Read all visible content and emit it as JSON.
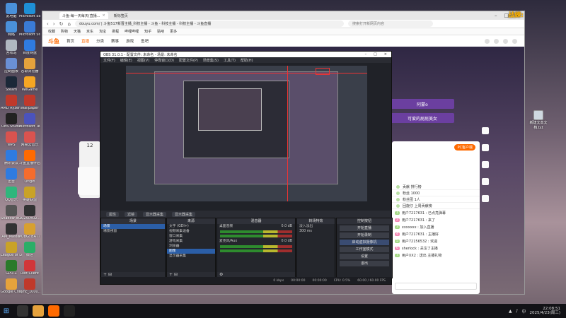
{
  "desktop": {
    "icons": [
      {
        "label": "此电脑",
        "color": "#4a90d9"
      },
      {
        "label": "Microsoft Edge",
        "color": "#1e8fd6"
      },
      {
        "label": "网络",
        "color": "#4a90d9"
      },
      {
        "label": "Microsoft Store",
        "color": "#3a7bd5"
      },
      {
        "label": "回收站",
        "color": "#b0b8c0"
      },
      {
        "label": "百度网盘",
        "color": "#2f7be0"
      },
      {
        "label": "控制面板",
        "color": "#6a8fd5"
      },
      {
        "label": "谷歌浏览器",
        "color": "#e6a23c"
      },
      {
        "label": "Steam",
        "color": "#1b2838"
      },
      {
        "label": "WeGame",
        "color": "#f5a623"
      },
      {
        "label": "AMD Ryzen Master",
        "color": "#c0392b"
      },
      {
        "label": "Wallpaper",
        "color": "#c0392b"
      },
      {
        "label": "OBS Studio",
        "color": "#222222"
      },
      {
        "label": "Microsoft Teams",
        "color": "#4b53bc"
      },
      {
        "label": "WPS",
        "color": "#d9534f"
      },
      {
        "label": "网易云音乐",
        "color": "#d9534f"
      },
      {
        "label": "腾讯会议",
        "color": "#2f7be0"
      },
      {
        "label": "斗鱼直播伴侣",
        "color": "#ff6a00"
      },
      {
        "label": "迅雷",
        "color": "#2f7be0"
      },
      {
        "label": "Origin",
        "color": "#f56c2d"
      },
      {
        "label": "QQ音乐",
        "color": "#2fb67c"
      },
      {
        "label": "英雄联盟",
        "color": "#c9a227"
      },
      {
        "label": "Shadow of the Tomb...",
        "color": "#555555"
      },
      {
        "label": "20250402...",
        "color": "#333333"
      },
      {
        "label": "AM_Master",
        "color": "#333333"
      },
      {
        "label": "PUBG: BATTLEGR...",
        "color": "#d8a030"
      },
      {
        "label": "League of Legends",
        "color": "#c9a227"
      },
      {
        "label": "微信",
        "color": "#2aae67"
      },
      {
        "label": "GPU-Z",
        "color": "#2a7a2a"
      },
      {
        "label": "Riot Client",
        "color": "#d13639"
      },
      {
        "label": "Google Chrome",
        "color": "#e6a23c"
      },
      {
        "label": "sync_1000...",
        "color": "#c0392b"
      }
    ],
    "recycle_bin": "新建文本文档.txt",
    "brand_tag": "战練:"
  },
  "browser": {
    "tabs": [
      {
        "label": "斗鱼-每一天每天(直播...",
        "active": true
      },
      {
        "label": "新标签页",
        "active": false
      }
    ],
    "url": "douyu.com/ | 斗鱼517新晋主播_科技主播 - 斗鱼 - 科技主播 - 科技主播 - 斗鱼直播",
    "search_placeholder": "搜索打开新网页内容",
    "bookmarks": [
      "收藏",
      "购物",
      "天猫",
      "京东",
      "淘宝",
      "携程",
      "哔哩哔哩",
      "知乎",
      "贴吧",
      "更多"
    ]
  },
  "site": {
    "logo": "斗鱼",
    "nav": [
      {
        "label": "首页",
        "active": false
      },
      {
        "label": "直播",
        "active": true
      },
      {
        "label": "分类",
        "active": false
      },
      {
        "label": "赛事",
        "active": false
      },
      {
        "label": "游戏",
        "active": false
      },
      {
        "label": "鱼吧",
        "active": false
      }
    ],
    "rank_number": "12",
    "right_buttons": [
      "阿蒙o",
      "可爱的屁屁美女"
    ],
    "pc_button": "PC客户端",
    "ranks": [
      "贡献 排行榜",
      "粉丝 1000",
      "粉丝团 1人",
      "回旋仔 上周贡献榜"
    ],
    "chat": [
      {
        "badge": "1",
        "text": "用户7217631 : 已点亮弹幕"
      },
      {
        "badge": "2",
        "text": "用户7217631 : 来了"
      },
      {
        "badge": "3",
        "text": "xxxxxxx : 加入直播"
      },
      {
        "badge": "4",
        "text": "用户7217631 : 主播好"
      },
      {
        "badge": "5",
        "text": "用户72156532 : 欢迎"
      },
      {
        "badge": "6",
        "text": "sherlock : 关注了主播"
      },
      {
        "badge": "7",
        "text": "用户XX2 : 送出 主播礼物"
      }
    ]
  },
  "obs": {
    "title": "OBS 31.0.1 - 配置文件: 未命名 - 场景: 未命名",
    "menu": [
      "文件(F)",
      "编辑(E)",
      "视图(V)",
      "停靠窗口(D)",
      "配置文件(P)",
      "场景集(S)",
      "工具(T)",
      "帮助(H)"
    ],
    "toolbar": [
      "属性",
      "滤镜",
      "显示器采集",
      "显示器采集"
    ],
    "scene_header": "场景",
    "scenes": [
      "场景",
      "場景視窗"
    ],
    "sources_header": "来源",
    "sources": [
      "文字 (GDI+)",
      "视频采集设备",
      "窗口采集",
      "游戏采集",
      "浏览器",
      "图像",
      "显示器采集"
    ],
    "mixer_header": "混音器",
    "mixer": [
      {
        "label": "桌面音频",
        "db": "0.0 dB"
      },
      {
        "label": "麦克风/Aux",
        "db": "0.0 dB"
      }
    ],
    "transitions_header": "转场特效",
    "transition_type": "淡入淡出",
    "transition_duration": "300 ms",
    "controls_header": "控制按钮",
    "controls": [
      "开始直播",
      "开始录制",
      "启动虚拟摄像机",
      "工作室模式",
      "设置",
      "退出"
    ],
    "status": [
      "0 kbps",
      "00:00:00",
      "00:00:00",
      "CPU: 0.5%",
      "60.00 / 60.00 FPS"
    ]
  },
  "taskbar": {
    "apps": [
      {
        "icon": "search-icon",
        "color": "#333333"
      },
      {
        "icon": "chrome-icon",
        "color": "#e6a23c"
      },
      {
        "icon": "douyu-icon",
        "color": "#ff6a00"
      },
      {
        "icon": "obs-icon",
        "color": "#222222"
      }
    ],
    "time": "22:08:51",
    "date": "2025/4/23(周三)",
    "lang": "中"
  }
}
